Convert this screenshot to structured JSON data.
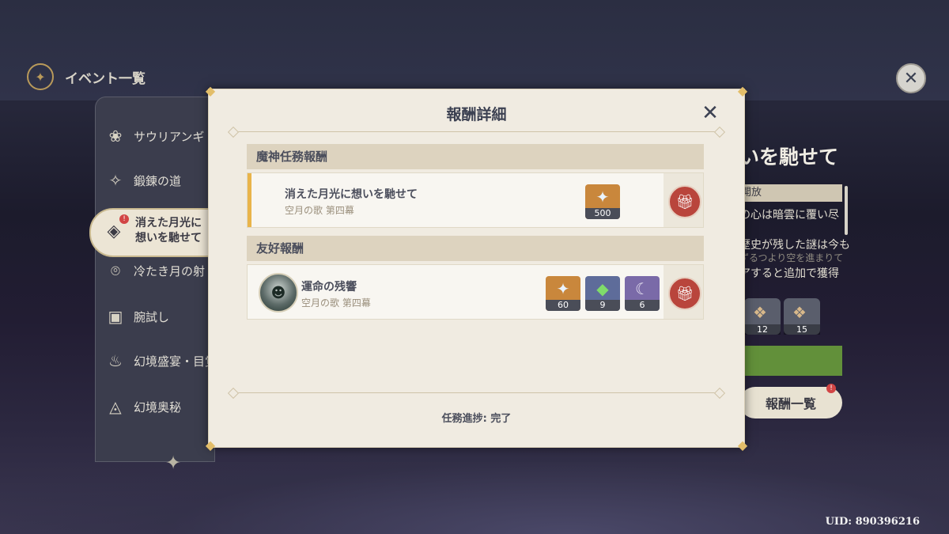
{
  "header": {
    "title": "イベント一覧"
  },
  "sidebar": {
    "items": [
      {
        "label": "サウリアンギ"
      },
      {
        "label": "鍛錬の道"
      },
      {
        "label_line1": "消えた月光に",
        "label_line2": "想いを馳せて",
        "active": true
      },
      {
        "label": "冷たき月の射"
      },
      {
        "label": "腕試し"
      },
      {
        "label": "幻境盛宴・目覚め"
      },
      {
        "label": "幻境奥秘"
      }
    ]
  },
  "right_panel": {
    "title": "いを馳せて",
    "tag": "開放",
    "line1": "の心は暗雲に覆い尽",
    "line2": "歴史が残した謎は今も",
    "line3": "ずるつより空を進まりて",
    "line4": "アすると追加で獲得",
    "rewards": [
      {
        "count": "12"
      },
      {
        "count": "15"
      }
    ],
    "button_label": "報酬一覧"
  },
  "modal": {
    "title": "報酬詳細",
    "section1": {
      "header": "魔神任務報酬",
      "row": {
        "title": "消えた月光に想いを馳せて",
        "subtitle": "空月の歌 第四幕",
        "items": [
          {
            "icon": "primogem-icon",
            "count": "500"
          }
        ]
      }
    },
    "section2": {
      "header": "友好報酬",
      "row": {
        "title": "運命の残響",
        "subtitle": "空月の歌 第四幕",
        "items": [
          {
            "icon": "primogem-icon",
            "count": "60"
          },
          {
            "icon": "green-crystal-icon",
            "count": "9"
          },
          {
            "icon": "purple-mask-icon",
            "count": "6"
          }
        ]
      }
    },
    "progress": "任務進捗: 完了"
  },
  "uid": "UID: 890396216"
}
